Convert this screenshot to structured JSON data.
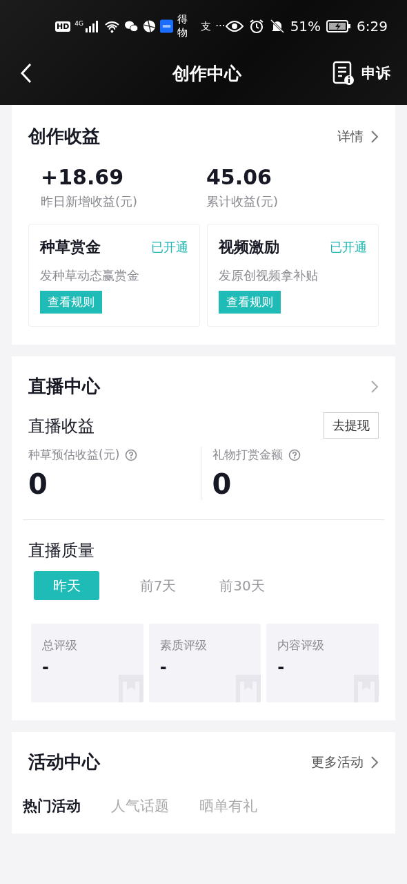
{
  "status_bar": {
    "left": [
      {
        "kind": "hd",
        "text": "HD"
      },
      {
        "kind": "signal",
        "text": "4G"
      },
      {
        "kind": "wifi"
      },
      {
        "kind": "chat"
      },
      {
        "kind": "globe"
      },
      {
        "kind": "app"
      },
      {
        "kind": "label",
        "text": "得物"
      },
      {
        "kind": "label",
        "text": "支"
      },
      {
        "kind": "label",
        "text": "···"
      }
    ],
    "battery": "51%",
    "time": "6:29"
  },
  "header": {
    "title": "创作中心",
    "action": "申诉"
  },
  "earnings": {
    "title": "创作收益",
    "link": "详情",
    "stats": [
      {
        "value": "+18.69",
        "label": "昨日新增收益(元)"
      },
      {
        "value": "45.06",
        "label": "累计收益(元)"
      }
    ],
    "programs": [
      {
        "title": "种草赏金",
        "status": "已开通",
        "desc": "发种草动态赢赏金",
        "button": "查看规则"
      },
      {
        "title": "视频激励",
        "status": "已开通",
        "desc": "发原创视频拿补贴",
        "button": "查看规则"
      }
    ]
  },
  "live": {
    "title": "直播中心",
    "income_title": "直播收益",
    "withdraw": "去提现",
    "stats": [
      {
        "label": "种草预估收益(元)",
        "value": "0"
      },
      {
        "label": "礼物打赏金额",
        "value": "0"
      }
    ],
    "quality_title": "直播质量",
    "periods": [
      {
        "label": "昨天",
        "selected": true
      },
      {
        "label": "前7天",
        "selected": false
      },
      {
        "label": "前30天",
        "selected": false
      }
    ],
    "ratings": [
      {
        "label": "总评级",
        "value": "-"
      },
      {
        "label": "素质评级",
        "value": "-"
      },
      {
        "label": "内容评级",
        "value": "-"
      }
    ]
  },
  "activities": {
    "title": "活动中心",
    "link": "更多活动",
    "tabs": [
      {
        "label": "热门活动",
        "selected": true
      },
      {
        "label": "人气话题",
        "selected": false
      },
      {
        "label": "晒单有礼",
        "selected": false
      }
    ]
  }
}
